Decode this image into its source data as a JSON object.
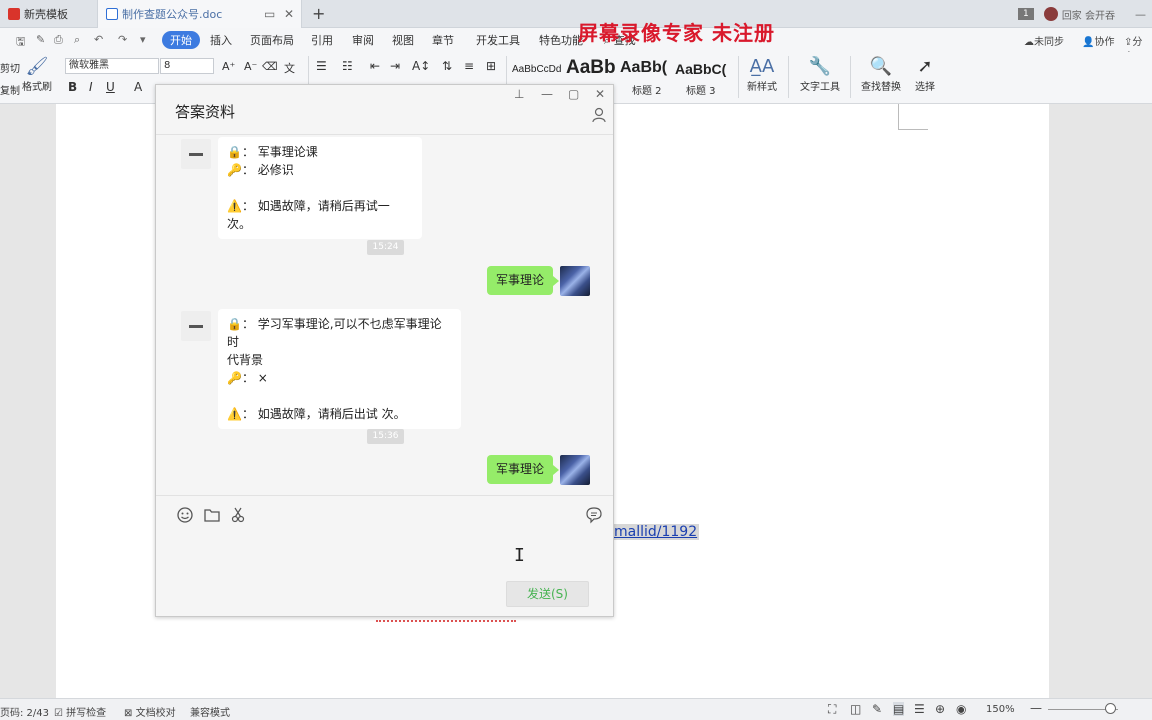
{
  "tabs": [
    {
      "label": "新壳模板",
      "icon": "wps-logo-icon"
    },
    {
      "label": "制作查题公众号.doc",
      "icon": "word-doc-icon"
    }
  ],
  "watermark": "屏幕录像专家  未注册",
  "account": {
    "badge": "1",
    "name": "回家 会开吞"
  },
  "menu": {
    "items": [
      "开始",
      "插入",
      "页面布局",
      "引用",
      "审阅",
      "视图",
      "章节",
      "开发工具",
      "特色功能"
    ],
    "search": "查找",
    "sync": "未同步",
    "collab": "协作",
    "share": "分享"
  },
  "ribbon": {
    "cut": "剪切",
    "copy": "复制",
    "format_painter": "格式刷",
    "font_name": "微软雅黑",
    "font_size": "8",
    "style_samples": [
      "AaBbCcDd",
      "AaBb",
      "AaBb(",
      "AaBbC("
    ],
    "style_labels": [
      "标题 2",
      "标题 3"
    ],
    "new_style": "新样式",
    "text_tool": "文字工具",
    "find_replace": "查找替换",
    "select": "选择"
  },
  "document": {
    "link_text": "mallid/1192"
  },
  "chat": {
    "title": "答案资料",
    "window_controls": [
      "pin-icon",
      "minimize-icon",
      "maximize-icon",
      "close-icon"
    ],
    "messages": [
      {
        "type": "bot",
        "lines": [
          "🔒： 军事理论课",
          "🔑： 必修识",
          "",
          "⚠️： 如遇故障，请稍后再试一次。"
        ]
      },
      {
        "type": "time",
        "text": "15:24"
      },
      {
        "type": "me",
        "text": "军事理论"
      },
      {
        "type": "bot",
        "lines": [
          "🔒： 学习军事理论,可以不乜虑军事理论时",
          "代背景",
          "🔑： ×",
          "",
          "⚠️： 如遇故障，请稍后出试   次。"
        ]
      },
      {
        "type": "time",
        "text": "15:36"
      },
      {
        "type": "me",
        "text": "军事理论"
      }
    ],
    "input_icons": [
      "emoji-icon",
      "folder-icon",
      "scissors-icon",
      "chat-history-icon"
    ],
    "send_label": "发送(S)"
  },
  "status": {
    "page": "页码: 2/43",
    "spell": "拼写检查",
    "proof": "文档校对",
    "compat": "兼容模式",
    "zoom": "150%"
  }
}
